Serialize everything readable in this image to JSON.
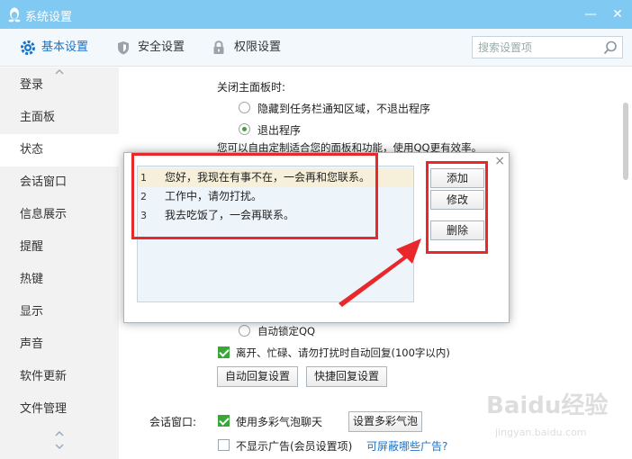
{
  "window": {
    "title": "系统设置",
    "minimize": "—",
    "close": "✕"
  },
  "toolbar": {
    "tabs": [
      {
        "label": "基本设置",
        "icon": "gear-icon"
      },
      {
        "label": "安全设置",
        "icon": "shield-icon"
      },
      {
        "label": "权限设置",
        "icon": "lock-icon"
      }
    ],
    "search_placeholder": "搜索设置项"
  },
  "sidebar": {
    "items": [
      "登录",
      "主面板",
      "状态",
      "会话窗口",
      "信息展示",
      "提醒",
      "热键",
      "显示",
      "声音",
      "软件更新",
      "文件管理"
    ],
    "active": "状态"
  },
  "content": {
    "close_panel_label": "关闭主面板时:",
    "option_hide": "隐藏到任务栏通知区域，不退出程序",
    "option_exit": "退出程序",
    "customize_text": "您可以自由定制适合您的面板和功能，使用QQ更有效率。",
    "auto_lock": "自动锁定QQ",
    "auto_reply": "离开、忙碌、请勿打扰时自动回复(100字以内)",
    "auto_reply_btn": "自动回复设置",
    "quick_reply_btn": "快捷回复设置",
    "session_label": "会话窗口:",
    "bubble_chat": "使用多彩气泡聊天",
    "bubble_btn": "设置多彩气泡",
    "no_ads": "不显示广告(会员设置项)",
    "ads_link": "可屏蔽哪些广告?"
  },
  "dialog": {
    "close": "×",
    "replies": [
      {
        "num": "1",
        "text": "您好，我现在有事不在，一会再和您联系。"
      },
      {
        "num": "2",
        "text": "工作中，请勿打扰。"
      },
      {
        "num": "3",
        "text": "我去吃饭了，一会再联系。"
      }
    ],
    "add_btn": "添加",
    "edit_btn": "修改",
    "delete_btn": "删除"
  },
  "watermark": {
    "main": "Baidu经验",
    "sub": "jingyan.baidu.com"
  },
  "colors": {
    "titlebar": "#7fc9f3",
    "accent": "#1a73c8",
    "highlight": "#e8282b",
    "check": "#3aa63a"
  }
}
